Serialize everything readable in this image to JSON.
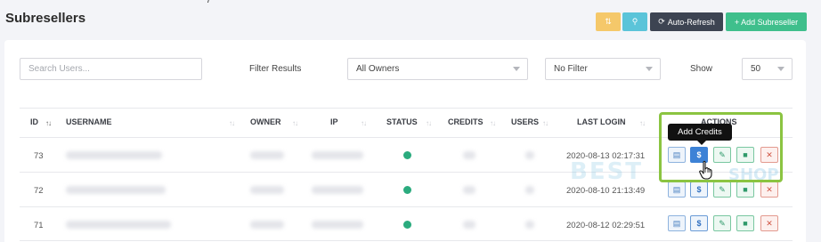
{
  "page": {
    "title": "Subresellers",
    "top_fragment": "/"
  },
  "toolbar": {
    "sort_icon": "sort-icon",
    "search_icon": "search-icon",
    "refresh_label": "Auto-Refresh",
    "refresh_symbol": "⟳",
    "add_label": "+ Add Subreseller",
    "sort_glyph": "⇅",
    "search_glyph": "⚲"
  },
  "filters": {
    "search_placeholder": "Search Users...",
    "filter_label": "Filter Results",
    "owner_value": "All Owners",
    "filter_value": "No Filter",
    "show_label": "Show",
    "show_value": "50"
  },
  "table": {
    "columns": [
      "ID",
      "USERNAME",
      "OWNER",
      "IP",
      "STATUS",
      "CREDITS",
      "USERS",
      "LAST LOGIN",
      "ACTIONS"
    ],
    "sort_glyph": "↑↓",
    "rows": [
      {
        "id": "73",
        "last_login": "2020-08-13 02:17:31",
        "status": "active"
      },
      {
        "id": "72",
        "last_login": "2020-08-10 21:13:49",
        "status": "active"
      },
      {
        "id": "71",
        "last_login": "2020-08-12 02:29:51",
        "status": "active"
      }
    ],
    "action_glyphs": {
      "doc": "▤",
      "credits": "$",
      "edit": "✎",
      "lock": "🔒",
      "delete": "✕"
    }
  },
  "tooltip": {
    "text": "Add Credits"
  },
  "watermark": {
    "text_main": "BEST",
    "text_shop": "SHOP"
  },
  "colors": {
    "green_status": "#2bab7e",
    "highlight": "#8bc441",
    "add_button": "#3fbf8c",
    "refresh_button": "#3d4452"
  }
}
